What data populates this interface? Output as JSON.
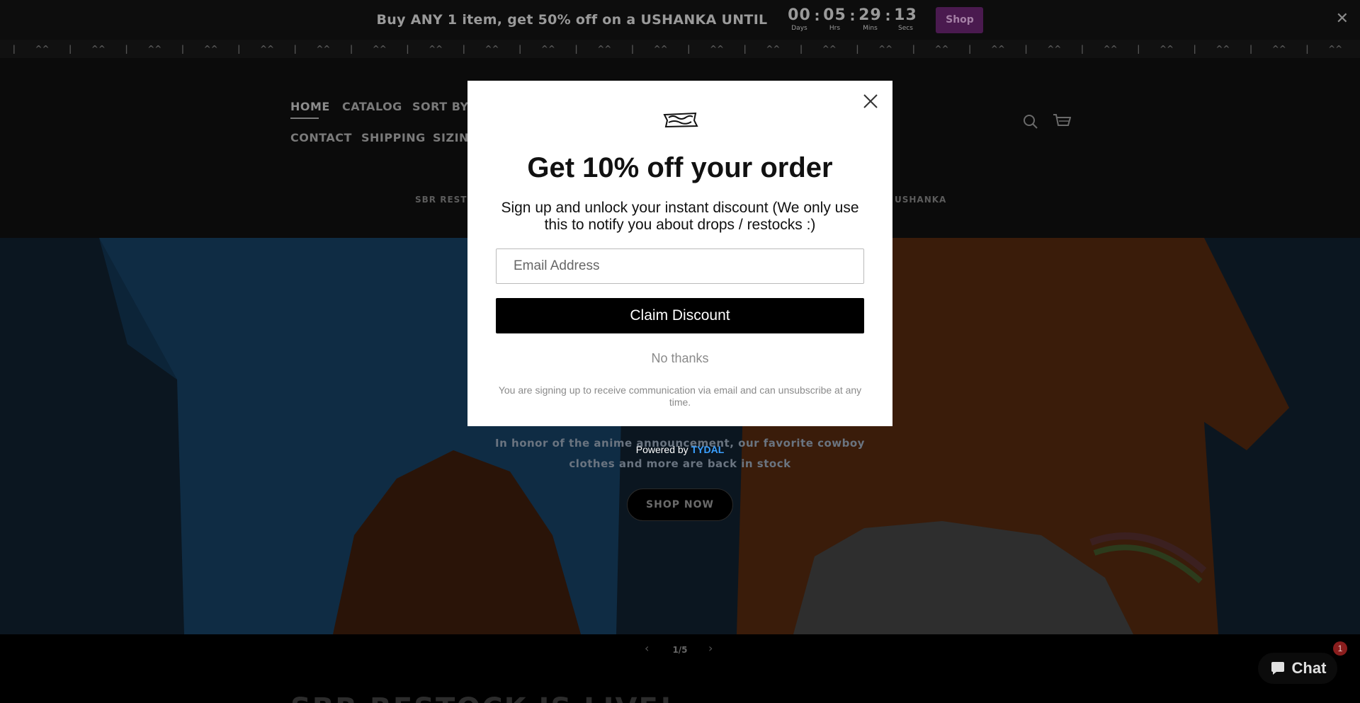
{
  "announcement": {
    "text": "Buy ANY 1 item, get 50% off on a USHANKA UNTIL",
    "countdown": {
      "days": "00",
      "days_label": "Days",
      "hours": "05",
      "hours_label": "Hrs",
      "minutes": "29",
      "minutes_label": "Mins",
      "seconds": "13",
      "seconds_label": "Secs"
    },
    "button_label": "Shop",
    "close_icon": "close-icon"
  },
  "marquee": {
    "token": "^^",
    "separator": "|"
  },
  "nav": {
    "row1": [
      "HOME",
      "CATALOG",
      "SORT BY A"
    ],
    "row2": [
      "CONTACT",
      "SHIPPING",
      "SIZING"
    ],
    "search_icon": "search-icon",
    "cart_icon": "cart-icon"
  },
  "promo": {
    "left": "SBR RESTOC",
    "right": "USHANKA"
  },
  "hero": {
    "subtitle_line1": "In honor of the anime announcement, our favorite cowboy",
    "subtitle_line2": "clothes and more are back in stock",
    "button_label": "SHOP NOW"
  },
  "slider": {
    "counter": "1/5",
    "prev_icon": "chevron-left-icon",
    "next_icon": "chevron-right-icon"
  },
  "section": {
    "heading": "SBR RESTOCK IS LIVE!"
  },
  "popup": {
    "title": "Get 10% off your order",
    "description": "Sign up and unlock your instant discount (We only use this to notify you about drops / restocks :)",
    "email_placeholder": "Email Address",
    "submit_label": "Claim Discount",
    "decline_label": "No thanks",
    "legal": "You are signing up to receive communication via email and can unsubscribe at any time.",
    "powered_by": "Powered by",
    "powered_brand": "TYDAL"
  },
  "chat": {
    "label": "Chat",
    "badge": "1"
  },
  "colors": {
    "announcement_bg": "#0d0d0d",
    "shop_button": "#4a1a4f",
    "popup_bg": "#ffffff",
    "claim_button": "#000000",
    "tydal_brand": "#3aa0ff"
  }
}
